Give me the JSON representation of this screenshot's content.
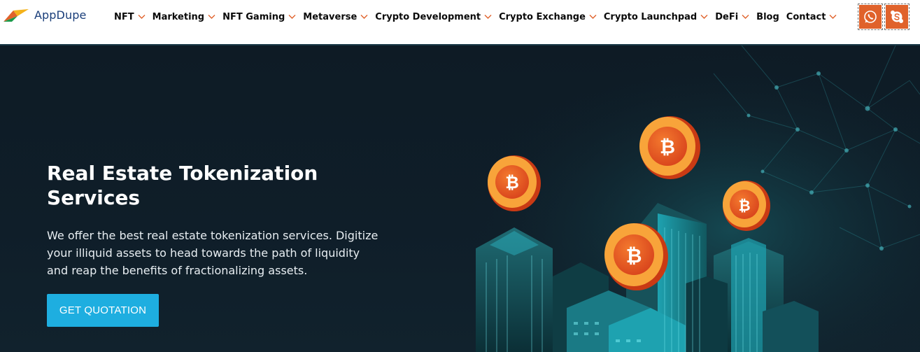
{
  "brand": {
    "name": "AppDupe",
    "logo_colors": [
      "#e0622b",
      "#f4b21b",
      "#1a9a4a"
    ]
  },
  "nav": {
    "items": [
      {
        "label": "NFT",
        "has_dropdown": true
      },
      {
        "label": "Marketing",
        "has_dropdown": true
      },
      {
        "label": "NFT Gaming",
        "has_dropdown": true
      },
      {
        "label": "Metaverse",
        "has_dropdown": true
      },
      {
        "label": "Crypto Development",
        "has_dropdown": true
      },
      {
        "label": "Crypto Exchange",
        "has_dropdown": true
      },
      {
        "label": "Crypto Launchpad",
        "has_dropdown": true
      },
      {
        "label": "DeFi",
        "has_dropdown": true
      },
      {
        "label": "Blog",
        "has_dropdown": false
      },
      {
        "label": "Contact",
        "has_dropdown": true
      }
    ],
    "chevron_color": "#e0622b"
  },
  "social": {
    "icons": [
      "whatsapp-icon",
      "skype-icon"
    ],
    "color": "#e0622b"
  },
  "hero": {
    "title": "Real Estate Tokenization Services",
    "description": "We offer the best real estate tokenization services. Digitize your illiquid assets to head towards the path of liquidity and reap the benefits of fractionalizing assets.",
    "cta_label": "GET QUOTATION",
    "cta_color": "#1eaee0",
    "background": "#0e1b25",
    "illustration_icons": [
      "bitcoin-coin-icon",
      "skyscraper-icon",
      "network-mesh-icon"
    ]
  }
}
